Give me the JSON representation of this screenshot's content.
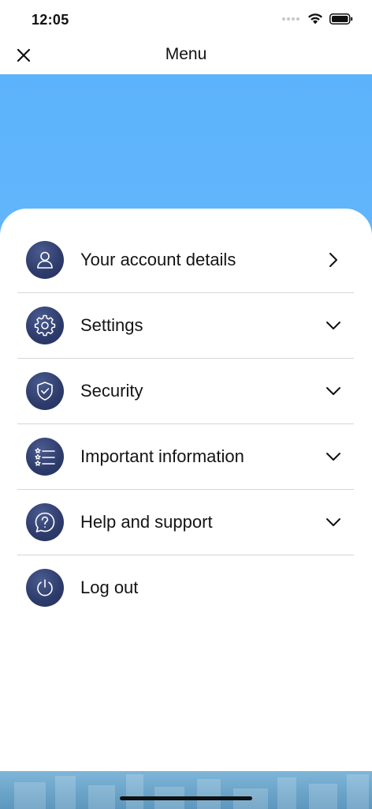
{
  "status_bar": {
    "time": "12:05"
  },
  "nav": {
    "title": "Menu"
  },
  "menu": {
    "items": [
      {
        "label": "Your account details",
        "icon": "user-icon",
        "chevron": "chevron-right-icon"
      },
      {
        "label": "Settings",
        "icon": "gear-icon",
        "chevron": "chevron-down-icon"
      },
      {
        "label": "Security",
        "icon": "shield-check-icon",
        "chevron": "chevron-down-icon"
      },
      {
        "label": "Important information",
        "icon": "starred-list-icon",
        "chevron": "chevron-down-icon"
      },
      {
        "label": "Help and support",
        "icon": "question-bubble-icon",
        "chevron": "chevron-down-icon"
      },
      {
        "label": "Log out",
        "icon": "power-icon",
        "chevron": ""
      }
    ]
  },
  "colors": {
    "hero": "#5db3fb",
    "icon_bg": "#2d3b6a",
    "divider": "#d6d6d6",
    "text": "#141414"
  }
}
